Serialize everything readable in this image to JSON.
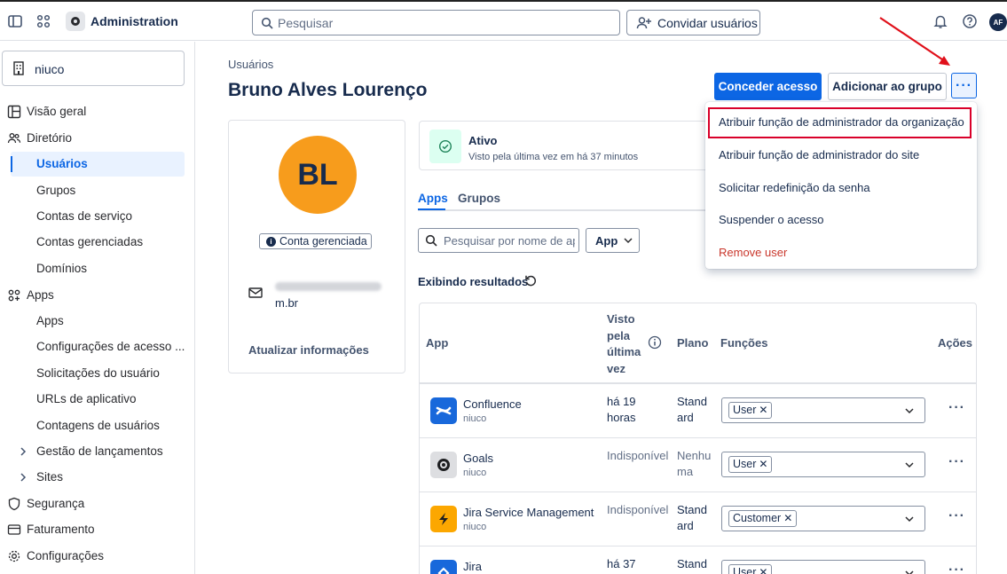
{
  "header": {
    "app_title": "Administration",
    "search_placeholder": "Pesquisar",
    "invite_label": "Convidar usuários",
    "avatar_initials": "AF"
  },
  "sidebar": {
    "org_name": "niuco",
    "items": [
      {
        "label": "Visão geral",
        "icon": "layout-icon",
        "level": "top"
      },
      {
        "label": "Diretório",
        "icon": "people-icon",
        "level": "top"
      },
      {
        "label": "Usuários",
        "level": "sub",
        "active": true
      },
      {
        "label": "Grupos",
        "level": "sub"
      },
      {
        "label": "Contas de serviço",
        "level": "sub"
      },
      {
        "label": "Contas gerenciadas",
        "level": "sub"
      },
      {
        "label": "Domínios",
        "level": "sub"
      },
      {
        "label": "Apps",
        "icon": "apps-icon",
        "level": "top"
      },
      {
        "label": "Apps",
        "level": "sub"
      },
      {
        "label": "Configurações de acesso ...",
        "level": "sub"
      },
      {
        "label": "Solicitações do usuário",
        "level": "sub"
      },
      {
        "label": "URLs de aplicativo",
        "level": "sub"
      },
      {
        "label": "Contagens de usuários",
        "level": "sub"
      },
      {
        "label": "Gestão de lançamentos",
        "level": "sub",
        "expandable": true
      },
      {
        "label": "Sites",
        "level": "sub",
        "expandable": true
      },
      {
        "label": "Segurança",
        "icon": "shield-icon",
        "level": "top"
      },
      {
        "label": "Faturamento",
        "icon": "card-icon",
        "level": "top"
      },
      {
        "label": "Configurações",
        "icon": "gear-icon",
        "level": "top"
      }
    ]
  },
  "main": {
    "breadcrumb": "Usuários",
    "title": "Bruno Alves Lourenço",
    "grant_access_label": "Conceder acesso",
    "add_to_group_label": "Adicionar ao grupo",
    "more_label": "···"
  },
  "profile": {
    "initials": "BL",
    "avatar_color": "#f79c1c",
    "managed_badge": "Conta gerenciada",
    "email_tail": "m.br",
    "update_link": "Atualizar informações"
  },
  "status": {
    "title": "Ativo",
    "subtitle": "Visto pela última vez em há 37 minutos"
  },
  "tabs": [
    {
      "label": "Apps",
      "active": true
    },
    {
      "label": "Grupos",
      "active": false
    }
  ],
  "apps_filter": {
    "search_placeholder": "Pesquisar por nome de app",
    "filter_label": "App",
    "results_label": "Exibindo resultados"
  },
  "table": {
    "headers": {
      "app": "App",
      "seen_1": "Visto",
      "seen_2": "pela",
      "seen_3": "última",
      "seen_4": "vez",
      "plan": "Plano",
      "roles": "Funções",
      "actions": "Ações"
    },
    "rows": [
      {
        "name": "Confluence",
        "site": "niuco",
        "seen": "há 19 horas",
        "plan": "Standard",
        "role": "User",
        "logo_color": "#1868db",
        "icon": "confluence-icon"
      },
      {
        "name": "Goals",
        "site": "niuco",
        "seen": "Indisponível",
        "plan": "Nenhuma",
        "role": "User",
        "logo_color": "#dddee1",
        "icon": "goals-icon"
      },
      {
        "name": "Jira Service Management",
        "site": "niuco",
        "seen": "Indisponível",
        "plan": "Standard",
        "role": "Customer",
        "logo_color": "#fca700",
        "icon": "jsm-icon"
      },
      {
        "name": "Jira",
        "site": "",
        "seen": "há 37",
        "plan": "Stand",
        "role": "User",
        "logo_color": "#1868db",
        "icon": "jira-icon"
      }
    ]
  },
  "menu": {
    "items": [
      {
        "label": "Atribuir função de administrador da organização",
        "highlighted": true
      },
      {
        "label": "Atribuir função de administrador do site"
      },
      {
        "label": "Solicitar redefinição da senha"
      },
      {
        "label": "Suspender o acesso"
      },
      {
        "label": "Remove user",
        "danger": true
      }
    ]
  },
  "colors": {
    "primary": "#0c66e4",
    "danger": "#c9372c",
    "annotation": "#d9002a"
  }
}
